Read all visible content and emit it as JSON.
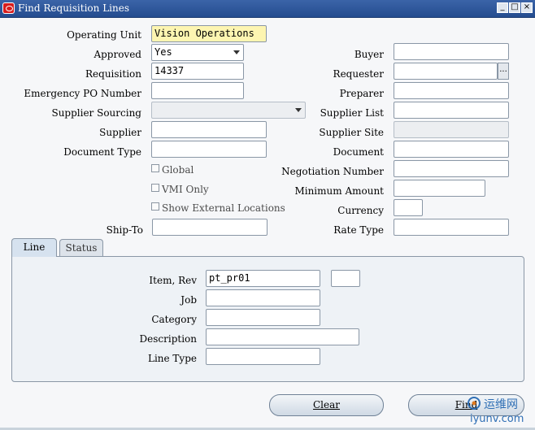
{
  "window": {
    "title": "Find Requisition Lines",
    "controls": [
      "_",
      "□",
      "×"
    ]
  },
  "form": {
    "operating_unit": {
      "label": "Operating Unit",
      "value": "Vision Operations"
    },
    "approved": {
      "label": "Approved",
      "value": "Yes"
    },
    "requisition": {
      "label": "Requisition",
      "value": "14337"
    },
    "emergency_po": {
      "label": "Emergency PO Number",
      "value": ""
    },
    "supplier_sourcing": {
      "label": "Supplier Sourcing",
      "value": ""
    },
    "supplier": {
      "label": "Supplier",
      "value": ""
    },
    "document_type": {
      "label": "Document Type",
      "value": ""
    },
    "global": {
      "label": "Global",
      "checked": false
    },
    "vmi_only": {
      "label": "VMI Only",
      "checked": false
    },
    "show_external": {
      "label": "Show External Locations",
      "checked": false
    },
    "ship_to": {
      "label": "Ship-To",
      "value": ""
    },
    "buyer": {
      "label": "Buyer",
      "value": ""
    },
    "requester": {
      "label": "Requester",
      "value": ""
    },
    "preparer": {
      "label": "Preparer",
      "value": ""
    },
    "supplier_list": {
      "label": "Supplier List",
      "value": ""
    },
    "supplier_site": {
      "label": "Supplier Site",
      "value": ""
    },
    "document": {
      "label": "Document",
      "value": ""
    },
    "negotiation_number": {
      "label": "Negotiation Number",
      "value": ""
    },
    "minimum_amount": {
      "label": "Minimum Amount",
      "value": ""
    },
    "currency": {
      "label": "Currency",
      "value": ""
    },
    "rate_type": {
      "label": "Rate Type",
      "value": ""
    },
    "lov_glyph": "..."
  },
  "tabs": [
    {
      "label": "Line",
      "active": true
    },
    {
      "label": "Status",
      "active": false
    }
  ],
  "line_tab": {
    "item_rev": {
      "label": "Item, Rev",
      "value": "pt_pr01",
      "rev": ""
    },
    "job": {
      "label": "Job",
      "value": ""
    },
    "category": {
      "label": "Category",
      "value": ""
    },
    "description": {
      "label": "Description",
      "value": ""
    },
    "line_type": {
      "label": "Line Type",
      "value": ""
    }
  },
  "buttons": {
    "clear": "Clear",
    "find": "Find"
  },
  "watermark": {
    "brand": "运维网",
    "site": "iyunv.com"
  },
  "colors": {
    "titlebar": "#2f58a0",
    "required_field": "#fdf5b1",
    "background": "#f6f7f9"
  }
}
